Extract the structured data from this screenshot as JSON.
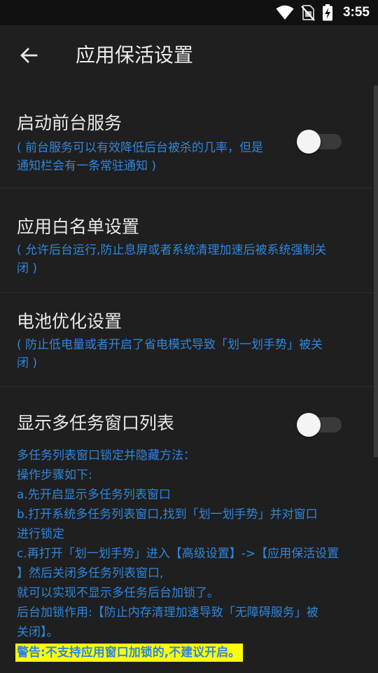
{
  "status_bar": {
    "time": "3:55",
    "icons": [
      "wifi-icon",
      "no-sim-icon",
      "battery-charging-icon"
    ]
  },
  "app_bar": {
    "back_icon": "arrow-left-icon",
    "title": "应用保活设置"
  },
  "settings": {
    "foreground_service": {
      "title": "启动前台服务",
      "desc_line1": "( 前台服务可以有效降低后台被杀的几率，但是",
      "desc_line2": "通知栏会有一条常驻通知 )",
      "enabled": false
    },
    "whitelist": {
      "title": "应用白名单设置",
      "desc_line1": "( 允许后台运行,防止息屏或者系统清理加速后被系统强制关",
      "desc_line2": "闭 )"
    },
    "battery": {
      "title": "电池优化设置",
      "desc_line1": "( 防止低电量或者开启了省电模式导致「划一划手势」被关",
      "desc_line2": "闭 )"
    },
    "multitask": {
      "title": "显示多任务窗口列表",
      "enabled": false,
      "info_lines": [
        "多任务列表窗口锁定并隐藏方法：",
        "操作步骤如下:",
        "a.先开启显示多任务列表窗口",
        "b.打开系统多任务列表窗口,找到「划一划手势」并对窗口",
        "进行锁定",
        "c.再打开「划一划手势」进入【高级设置】->【应用保活设置",
        "】然后关闭多任务列表窗口,",
        "就可以实现不显示多任务后台加锁了。",
        "后台加锁作用:【防止内存清理加速导致「无障碍服务」被",
        "关闭】。"
      ],
      "warning": "警告:不支持应用窗口加锁的,不建议开启。"
    }
  },
  "colors": {
    "background": "#1f1f1f",
    "status_bar": "#111111",
    "accent_text": "#2f86dd",
    "warning_bg": "#ffff00"
  }
}
